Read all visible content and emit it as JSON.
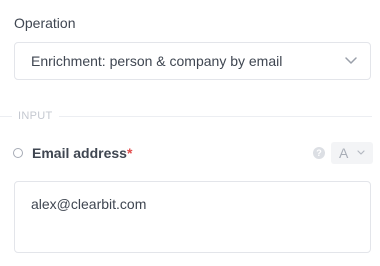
{
  "operation": {
    "label": "Operation",
    "selected_value": "Enrichment: person & company by email"
  },
  "section": {
    "title": "INPUT"
  },
  "email_field": {
    "label": "Email address",
    "required_marker": "*",
    "help_glyph": "?",
    "type_indicator": "A",
    "value": "alex@clearbit.com"
  },
  "colors": {
    "required": "#e24b4b",
    "text": "#3f4651",
    "border": "#e3e5ea",
    "muted": "#c4c8d0"
  },
  "icons": {
    "select": "chevron-down-icon",
    "radio": "radio-icon",
    "help": "help-icon",
    "type": "chevron-down-icon"
  }
}
